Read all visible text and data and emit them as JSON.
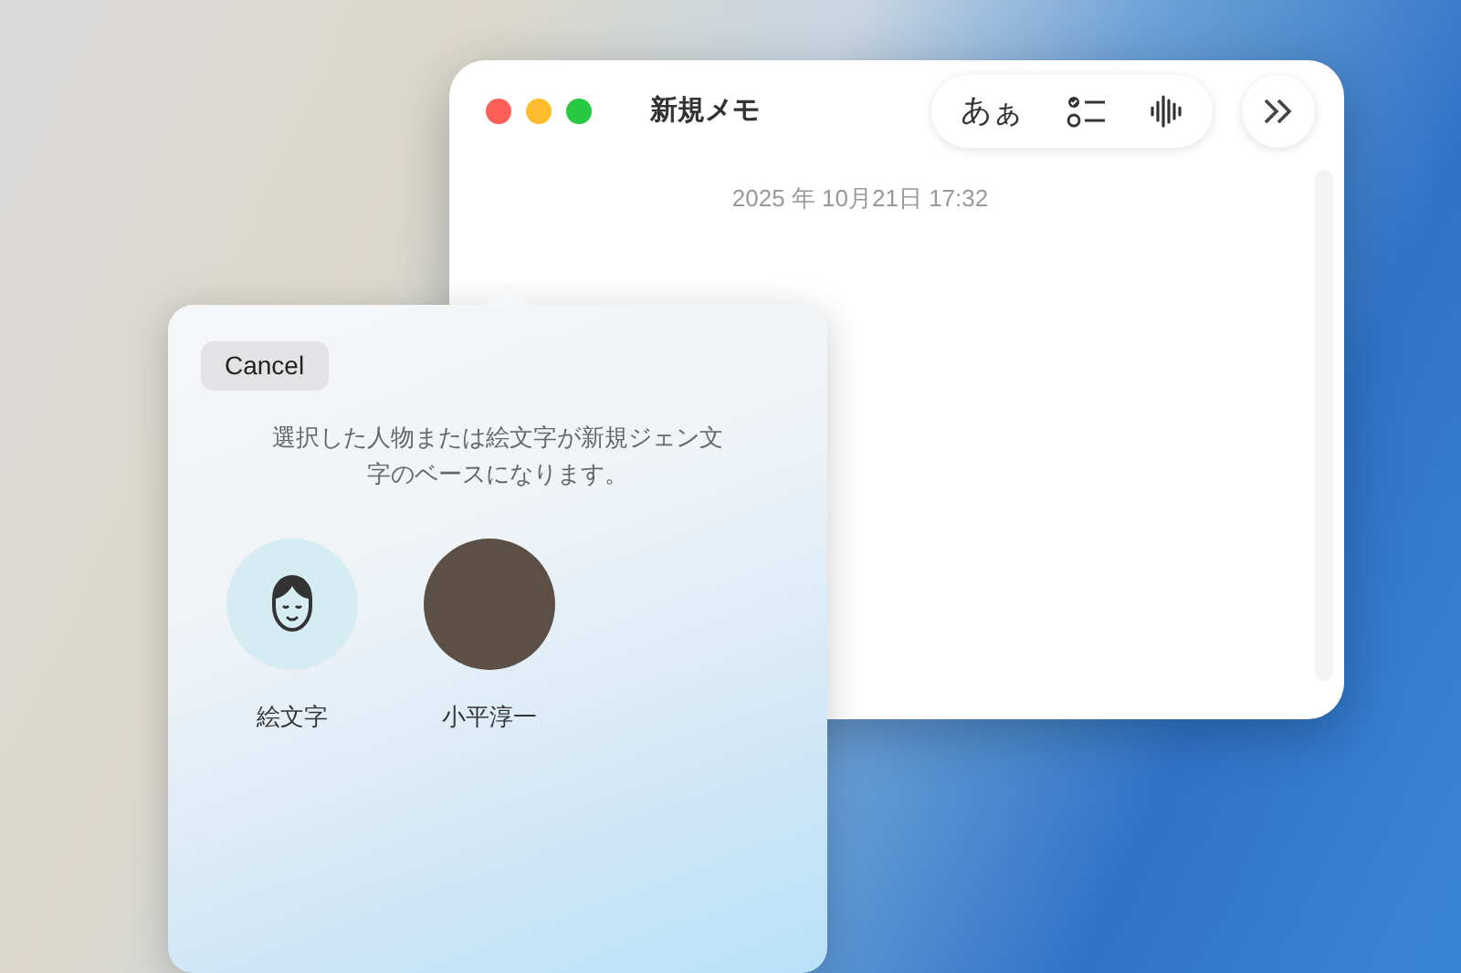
{
  "notes_window": {
    "title": "新規メモ",
    "toolbar": {
      "format_label": "あぁ"
    },
    "date": "2025 年 10月21日 17:32"
  },
  "popover": {
    "cancel": "Cancel",
    "message": "選択した人物または絵文字が新規ジェン文字のベースになります。",
    "choices": [
      {
        "kind": "emoji",
        "label": "絵文字"
      },
      {
        "kind": "photo",
        "label": "小平淳一"
      }
    ]
  }
}
